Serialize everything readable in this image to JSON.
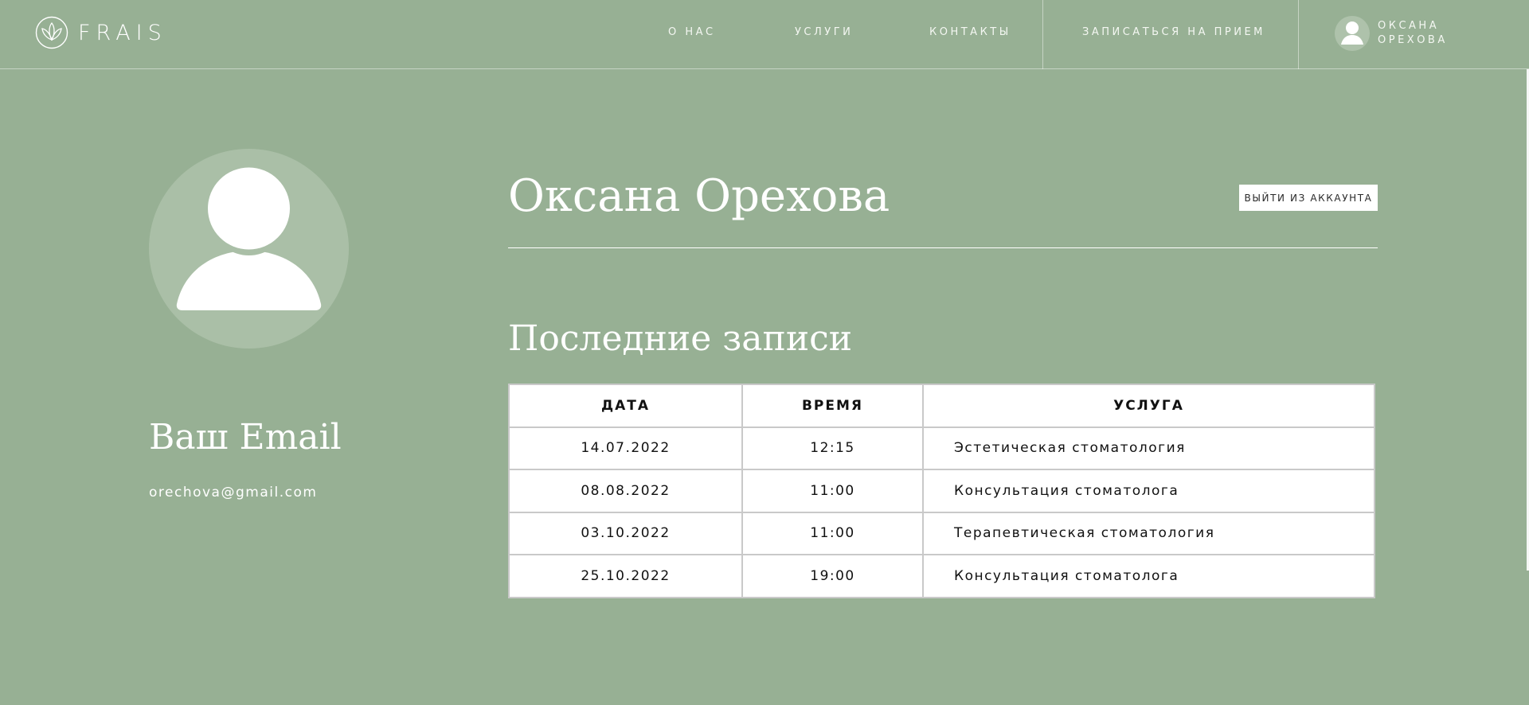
{
  "header": {
    "logo_text": "FRAIS",
    "nav": [
      {
        "label": "О НАС"
      },
      {
        "label": "УСЛУГИ"
      },
      {
        "label": "КОНТАКТЫ"
      },
      {
        "label": "ЗАПИСАТЬСЯ НА ПРИЕМ"
      }
    ],
    "user": {
      "first_name": "ОКСАНА",
      "last_name": "ОРЕХОВА"
    }
  },
  "profile": {
    "name": "Оксана Орехова",
    "logout_label": "ВЫЙТИ ИЗ АККАУНТА",
    "email_title": "Ваш Email",
    "email": "orechova@gmail.com"
  },
  "appointments": {
    "title": "Последние записи",
    "columns": [
      "ДАТА",
      "ВРЕМЯ",
      "УСЛУГА"
    ],
    "rows": [
      {
        "date": "14.07.2022",
        "time": "12:15",
        "service": "Эстетическая стоматология"
      },
      {
        "date": "08.08.2022",
        "time": "11:00",
        "service": "Консультация стоматолога"
      },
      {
        "date": "03.10.2022",
        "time": "11:00",
        "service": "Терапевтическая стоматология"
      },
      {
        "date": "25.10.2022",
        "time": "19:00",
        "service": "Консультация стоматолога"
      }
    ]
  },
  "colors": {
    "background": "#97b094",
    "avatar_circle": "#aabfa7",
    "text": "#ffffff"
  },
  "icons": {
    "logo": "lotus-icon",
    "avatar": "user-silhouette-icon"
  }
}
